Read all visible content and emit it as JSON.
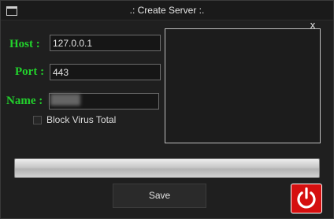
{
  "window": {
    "title": ".: Create Server :.",
    "close_glyph": "x",
    "icon": "app-window-icon"
  },
  "form": {
    "host": {
      "label": "Host :",
      "value": "127.0.0.1"
    },
    "port": {
      "label": "Port :",
      "value": "443"
    },
    "name": {
      "label": "Name :",
      "value": ""
    },
    "block_virus_total": {
      "label": "Block Virus Total",
      "checked": false
    }
  },
  "progress": {
    "percent": 0
  },
  "buttons": {
    "save_label": "Save",
    "power_icon": "power-icon"
  },
  "colors": {
    "background": "#1f1f1f",
    "label_green": "#22d12c",
    "power_red": "#d50f0f"
  }
}
